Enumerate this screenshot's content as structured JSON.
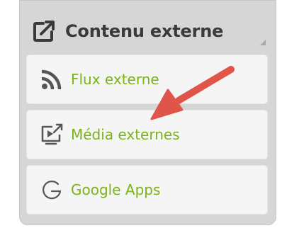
{
  "panel": {
    "title": "Contenu externe",
    "title_icon": "external-link-icon"
  },
  "items": [
    {
      "label": "Flux externe",
      "icon": "rss-feed-icon"
    },
    {
      "label": "Média externes",
      "icon": "external-media-icon"
    },
    {
      "label": "Google Apps",
      "icon": "google-icon"
    }
  ],
  "annotation": {
    "type": "arrow",
    "color": "#e0554a",
    "points_to": "Média externes"
  },
  "colors": {
    "panel_bg": "#d6d6d6",
    "item_bg": "#f5f5f5",
    "item_text": "#7bb31a",
    "header_text": "#3a3a3a"
  }
}
